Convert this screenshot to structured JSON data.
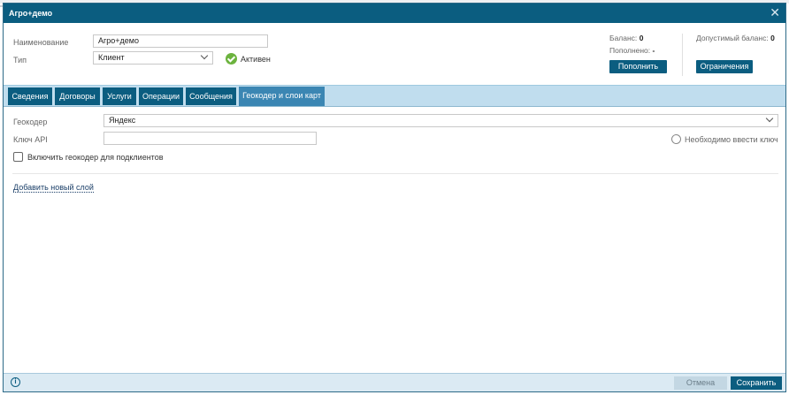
{
  "dialog": {
    "title": "Агро+демо"
  },
  "form": {
    "name_label": "Наименование",
    "name_value": "Агро+демо",
    "type_label": "Тип",
    "type_value": "Клиент",
    "status_text": "Активен"
  },
  "balance": {
    "balance_label": "Баланс:",
    "balance_value": "0",
    "replenished_label": "Пополнено:",
    "replenished_value": "-",
    "topup_button": "Пополнить",
    "allowed_label": "Допустимый баланс:",
    "allowed_value": "0",
    "limits_button": "Ограничения"
  },
  "tabs": [
    {
      "label": "Сведения"
    },
    {
      "label": "Договоры"
    },
    {
      "label": "Услуги"
    },
    {
      "label": "Операции"
    },
    {
      "label": "Сообщения"
    },
    {
      "label": "Геокодер и слои карт"
    }
  ],
  "geocoder": {
    "geocoder_label": "Геокодер",
    "geocoder_value": "Яндекс",
    "api_key_label": "Ключ API",
    "api_key_value": "",
    "key_required_text": "Необходимо ввести ключ",
    "subclients_checkbox_label": "Включить геокодер для подклиентов",
    "add_layer_link": "Добавить новый слой"
  },
  "footer": {
    "info_icon": "i",
    "cancel_button": "Отмена",
    "save_button": "Сохранить"
  },
  "colors": {
    "primary": "#0b5d80",
    "active_tab": "#3b86b3",
    "status_ok": "#6cb33e"
  }
}
